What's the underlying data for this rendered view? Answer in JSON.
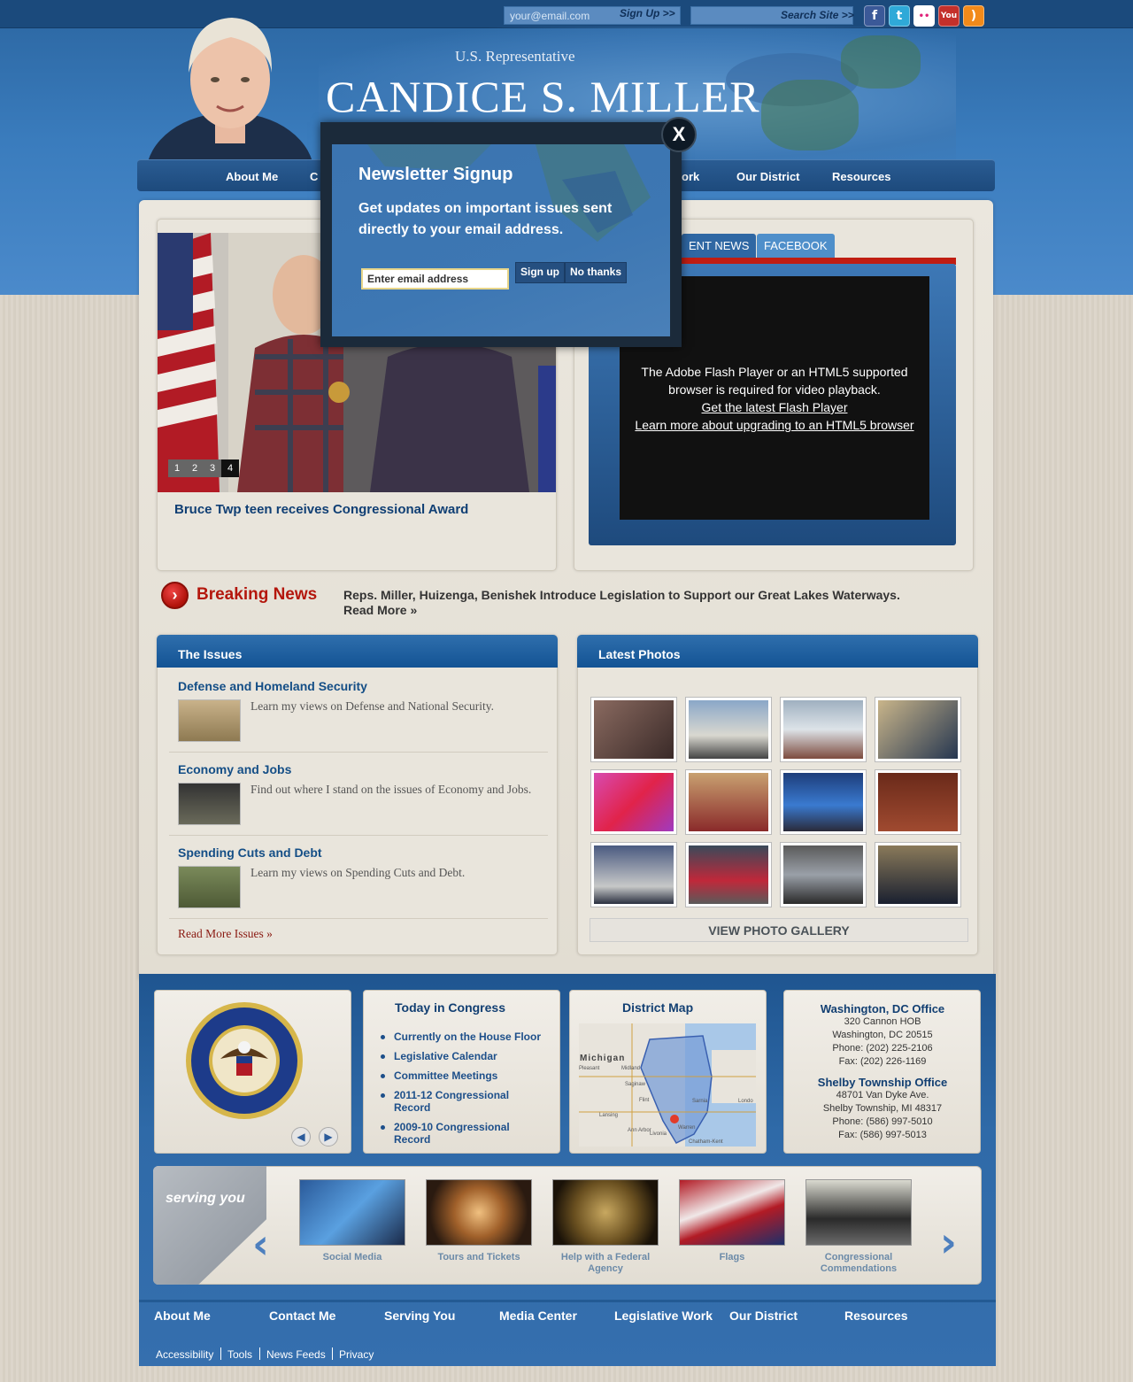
{
  "header": {
    "email_placeholder": "your@email.com",
    "signup_label": "Sign Up >>",
    "search_label": "Search Site >>",
    "rep_label": "U.S. Representative",
    "rep_name": "CANDICE S. MILLER"
  },
  "social": [
    {
      "icon": "facebook-icon",
      "glyph": "f",
      "color": "#3b5998"
    },
    {
      "icon": "twitter-icon",
      "glyph": "t",
      "color": "#2fa9d8"
    },
    {
      "icon": "flickr-icon",
      "glyph": "••",
      "color": "#ffffff"
    },
    {
      "icon": "youtube-icon",
      "glyph": "You",
      "color": "#c4302b"
    },
    {
      "icon": "rss-icon",
      "glyph": ")",
      "color": "#f28a1a"
    }
  ],
  "nav": [
    "About Me",
    "C",
    "ork",
    "Our District",
    "Resources"
  ],
  "slideshow": {
    "pages": [
      "1",
      "2",
      "3",
      "4"
    ],
    "caption": "Bruce Twp teen receives Congressional Award"
  },
  "media": {
    "tabs": [
      "ENT NEWS",
      "FACEBOOK"
    ],
    "flash_line1": "The Adobe Flash Player or an HTML5 supported browser is required for video playback.",
    "flash_link1": "Get the latest Flash Player",
    "flash_link2": "Learn more about upgrading to an HTML5 browser"
  },
  "breaking": {
    "title": "Breaking News",
    "text": "Reps. Miller, Huizenga, Benishek Introduce Legislation to Support our Great Lakes Waterways.",
    "more": "Read More »"
  },
  "issues": {
    "heading": "The Issues",
    "items": [
      {
        "title": "Defense and Homeland Security",
        "text": "Learn my views on Defense and National Security."
      },
      {
        "title": "Economy and Jobs",
        "text": "Find out where I stand on the issues of Economy and Jobs."
      },
      {
        "title": "Spending Cuts and Debt",
        "text": "Learn my views on Spending Cuts and Debt."
      }
    ],
    "more": "Read More Issues »"
  },
  "photos": {
    "heading": "Latest Photos",
    "gallery_button": "VIEW PHOTO GALLERY"
  },
  "footer_boxes": {
    "congress_title": "Today in Congress",
    "congress_links": [
      "Currently on the House Floor",
      "Legislative Calendar",
      "Committee Meetings",
      "2011-12 Congressional Record",
      "2009-10 Congressional Record"
    ],
    "map_title": "District Map",
    "map_state": "Michigan",
    "map_places": [
      "Pleasant",
      "Midland",
      "Saginaw",
      "Flint",
      "Lansing",
      "Sarnia",
      "Londo",
      "Chatham-Kent",
      "Ann Arbor",
      "Livonia",
      "Warren"
    ],
    "dc_office": {
      "title": "Washington, DC Office",
      "lines": [
        "320 Cannon HOB",
        "Washington, DC 20515",
        "Phone: (202) 225-2106",
        "Fax: (202) 226-1169"
      ]
    },
    "shelby_office": {
      "title": "Shelby Township Office",
      "lines": [
        "48701 Van Dyke Ave.",
        "Shelby Township, MI 48317",
        "Phone: (586) 997-5010",
        "Fax: (586) 997-5013"
      ]
    }
  },
  "serving": {
    "label": "serving you",
    "items": [
      "Social Media",
      "Tours and Tickets",
      "Help with a Federal Agency",
      "Flags",
      "Congressional Commendations"
    ]
  },
  "footer_nav": [
    "About Me",
    "Contact Me",
    "Serving You",
    "Media Center",
    "Legislative Work",
    "Our District",
    "Resources"
  ],
  "utility": [
    "Accessibility",
    "Tools",
    "News Feeds",
    "Privacy"
  ],
  "modal": {
    "title": "Newsletter Signup",
    "text": "Get updates on important issues sent directly to your email address.",
    "input_value": "Enter email address",
    "signup": "Sign up",
    "no_thanks": "No thanks",
    "close": "X"
  }
}
